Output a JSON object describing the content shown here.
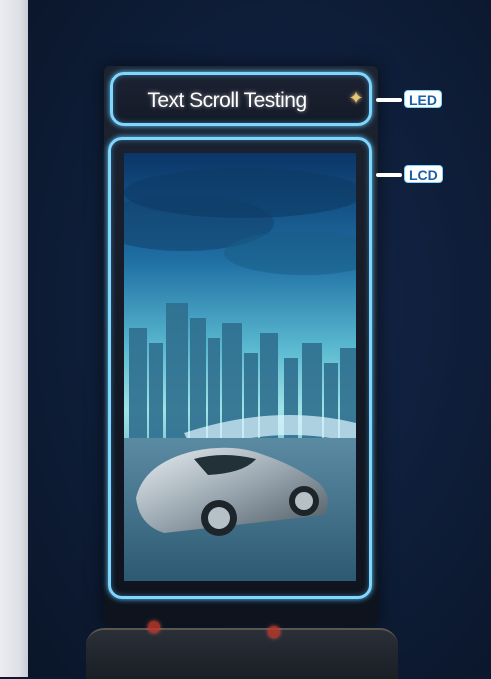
{
  "led": {
    "label": "LED",
    "scroll_text": "Text Scroll Testing"
  },
  "lcd": {
    "label": "LCD"
  },
  "colors": {
    "highlight_outline": "#7fd6ff",
    "label_text": "#1c5fa8"
  }
}
